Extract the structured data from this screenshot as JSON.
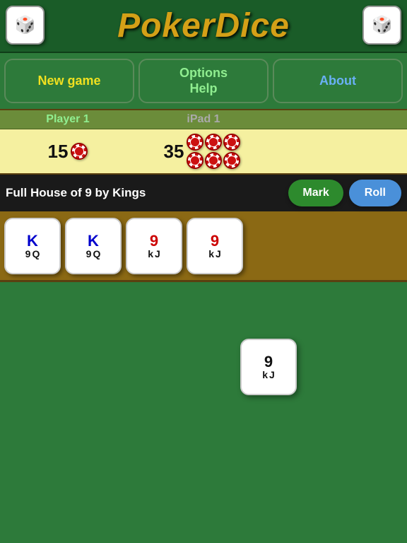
{
  "header": {
    "title": "PokerDice"
  },
  "nav": {
    "newgame_label": "New game",
    "options_label": "Options\nHelp",
    "about_label": "About"
  },
  "scores": {
    "player1_label": "Player 1",
    "ipad1_label": "iPad 1",
    "player1_score": "15",
    "ipad1_score": "35"
  },
  "action": {
    "hand_description": "Full House of 9 by Kings",
    "mark_label": "Mark",
    "roll_label": "Roll"
  },
  "tray_dice": [
    {
      "id": "d1",
      "top": "K",
      "top_color": "blue",
      "bot_left": "9",
      "bot_right": "Q"
    },
    {
      "id": "d2",
      "top": "K",
      "top_color": "blue",
      "bot_left": "9",
      "bot_right": "Q"
    },
    {
      "id": "d3",
      "top": "9",
      "top_color": "red",
      "bot_left": "k",
      "bot_right": "J"
    },
    {
      "id": "d4",
      "top": "9",
      "top_color": "red",
      "bot_left": "k",
      "bot_right": "J"
    }
  ],
  "single_die": {
    "top": "9",
    "top_color": "black",
    "bot_left": "k",
    "bot_right": "J"
  },
  "icons": {
    "dice_icon": "🎲"
  }
}
